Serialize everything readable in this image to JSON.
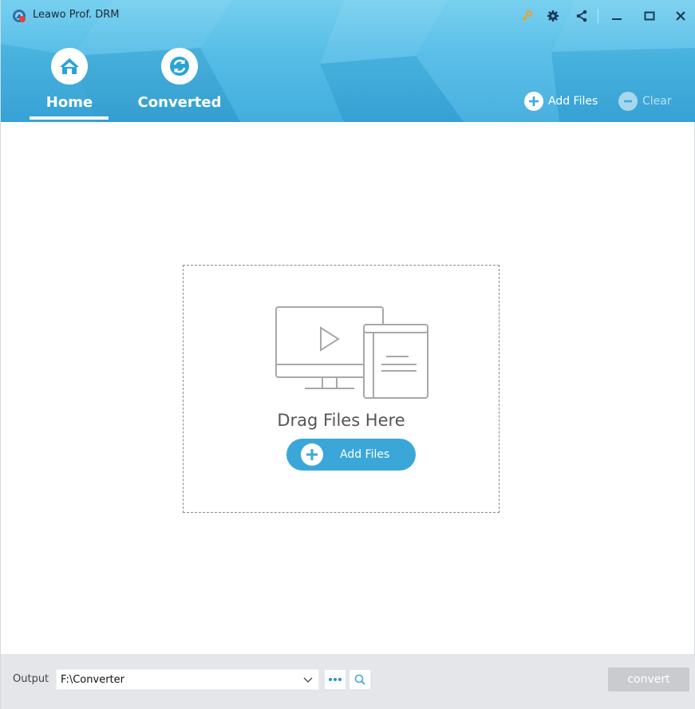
{
  "window": {
    "title": "Leawo Prof. DRM"
  },
  "titlebar": {
    "icons": [
      "key-icon",
      "gear-icon",
      "share-icon",
      "minimize-icon",
      "maximize-icon",
      "close-icon"
    ]
  },
  "nav": {
    "tabs": [
      {
        "label": "Home",
        "icon": "home-icon",
        "active": true
      },
      {
        "label": "Converted",
        "icon": "refresh-icon",
        "active": false
      }
    ]
  },
  "header_actions": {
    "add_files_label": "Add Files",
    "clear_label": "Clear"
  },
  "dropzone": {
    "text": "Drag Files Here",
    "add_files_label": "Add Files"
  },
  "bottom": {
    "output_label": "Output",
    "output_path": "F:\\Converter",
    "convert_label": "convert"
  },
  "colors": {
    "accent": "#3ba7d8",
    "header_top": "#6fcdee",
    "header_bottom": "#3aa9dc",
    "key_icon": "#f0a020",
    "convert_disabled": "#c9cbce"
  }
}
